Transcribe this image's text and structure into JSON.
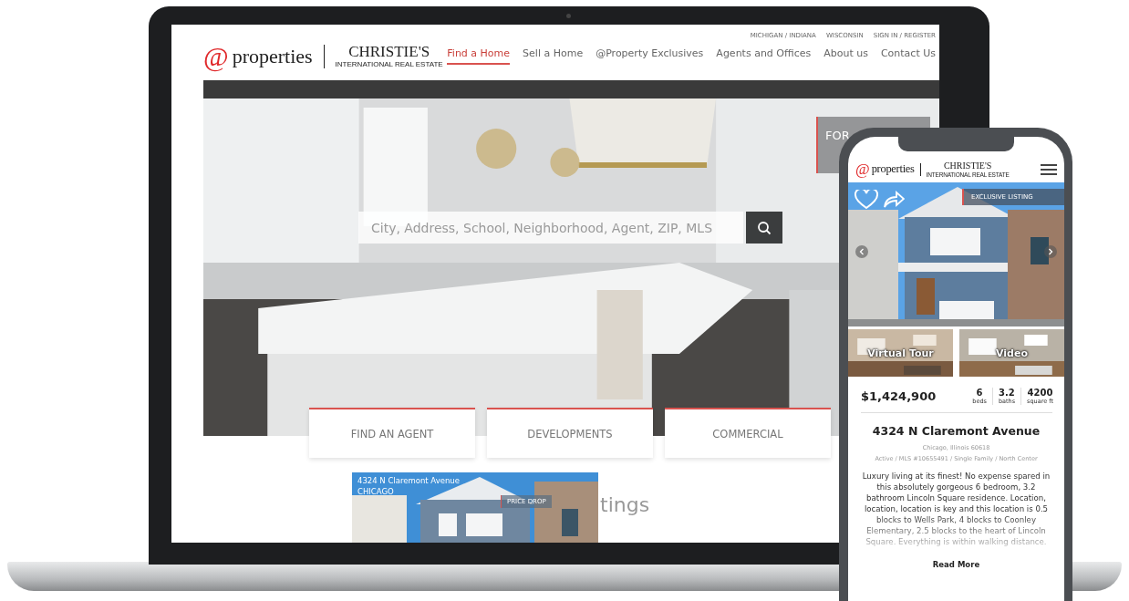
{
  "laptop": {
    "brand": {
      "at": "@",
      "name": "properties",
      "partner": "CHRISTIE'S",
      "partner_sub": "INTERNATIONAL REAL ESTATE"
    },
    "top_links": [
      "MICHIGAN / INDIANA",
      "WISCONSIN",
      "SIGN IN / REGISTER"
    ],
    "nav": [
      {
        "label": "Find a Home",
        "selected": true
      },
      {
        "label": "Sell a Home",
        "selected": false
      },
      {
        "label": "@Property Exclusives",
        "selected": false
      },
      {
        "label": "Agents and Offices",
        "selected": false
      },
      {
        "label": "About us",
        "selected": false
      },
      {
        "label": "Contact Us",
        "selected": false
      }
    ],
    "search": {
      "placeholder": "City, Address, School, Neighborhood, Agent, ZIP, MLS"
    },
    "side_card": "FOR",
    "categories": [
      "FIND AN AGENT",
      "DEVELOPMENTS",
      "COMMERCIAL"
    ],
    "listing_card": {
      "address": "4324 N Claremont Avenue",
      "city": "CHICAGO",
      "tag": "PRICE DROP"
    },
    "section_heading": "tings"
  },
  "phone": {
    "brand": {
      "at": "@",
      "name": "properties",
      "partner": "CHRISTIE'S",
      "partner_sub": "INTERNATIONAL REAL ESTATE"
    },
    "tag": "EXCLUSIVE LISTING",
    "media": [
      "Virtual Tour",
      "Video"
    ],
    "price": "$1,424,900",
    "stats": [
      {
        "value": "6",
        "unit": "beds"
      },
      {
        "value": "3.2",
        "unit": "baths"
      },
      {
        "value": "4200",
        "unit": "square ft"
      }
    ],
    "title": "4324 N Claremont Avenue",
    "address": "Chicago, Illinois 60618",
    "meta": "Active / MLS #10655491  / Single Family / North Center",
    "description": "Luxury living at its finest! No expense spared in this absolutely gorgeous 6 bedroom, 3.2 bathroom Lincoln Square residence. Location, location, location is key and this location is 0.5 blocks to Wells Park, 4 blocks to Coonley Elementary, 2.5 blocks to the heart of Lincoln Square. Everything is within walking distance.",
    "read_more": "Read More"
  }
}
